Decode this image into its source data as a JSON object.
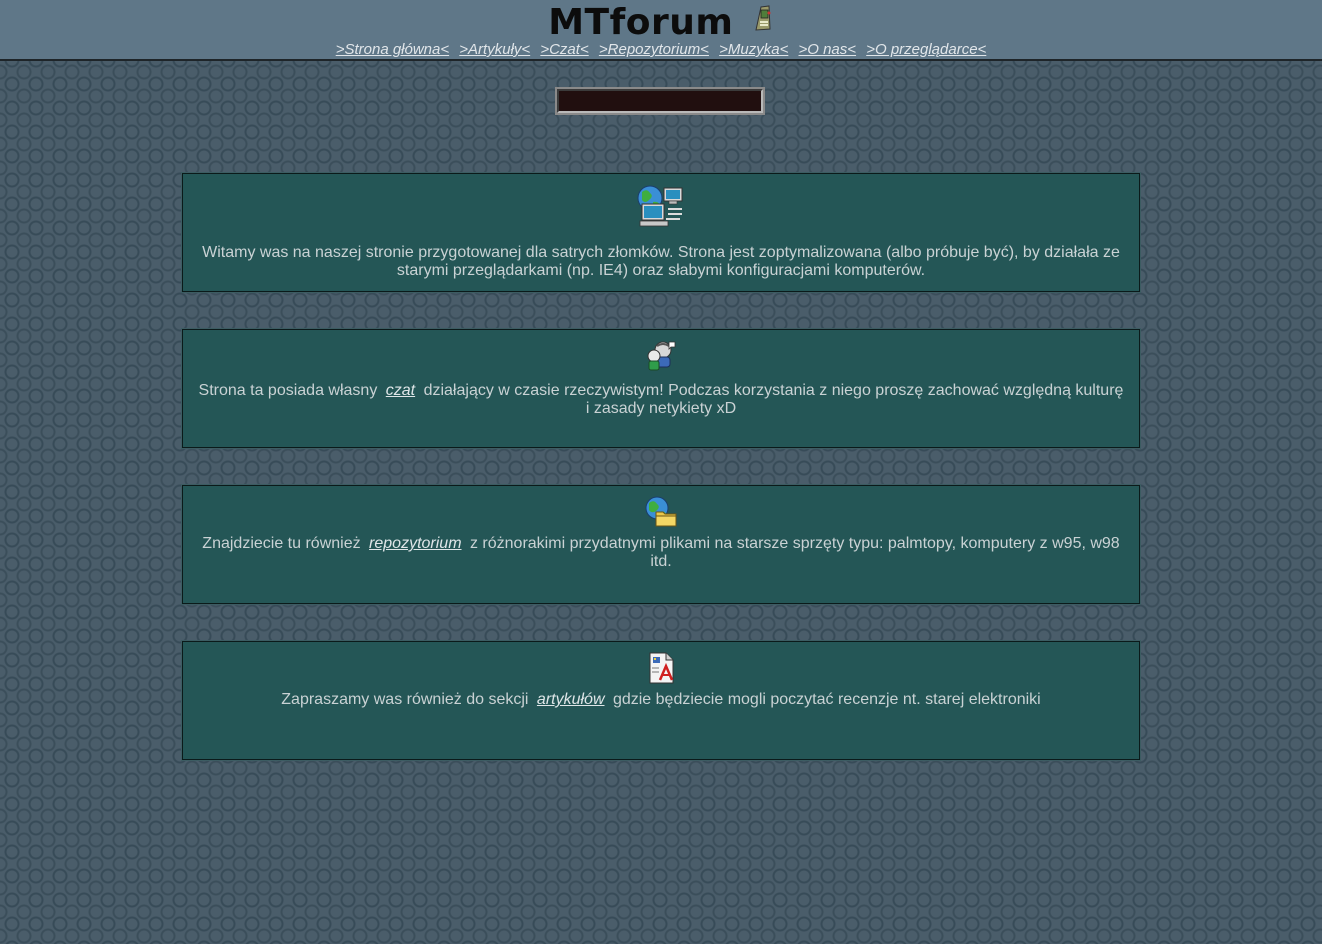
{
  "header": {
    "title": "MTforum",
    "logo_icon": "palmtop-icon",
    "nav": [
      {
        "label": ">Strona główna<"
      },
      {
        "label": ">Artykuły<"
      },
      {
        "label": ">Czat<"
      },
      {
        "label": ">Repozytorium<"
      },
      {
        "label": ">Muzyka<"
      },
      {
        "label": ">O nas<"
      },
      {
        "label": ">O przeglądarce<"
      }
    ]
  },
  "search": {
    "value": ""
  },
  "panels": [
    {
      "icon": "network-computers-icon",
      "before": "Witamy was na naszej stronie przygotowanej dla satrych złomków. Strona jest zoptymalizowana (albo próbuje być), by działała ze starymi przeglądarkami (np. IE4) oraz słabymi konfiguracjami komputerów.",
      "link": "",
      "after": ""
    },
    {
      "icon": "chat-users-icon",
      "before": "Strona ta posiada własny",
      "link": "czat",
      "after": "działający w czasie rzeczywistym! Podczas korzystania z niego proszę zachować względną kulturę i zasady netykiety xD"
    },
    {
      "icon": "globe-folder-icon",
      "before": "Znajdziecie tu również",
      "link": "repozytorium",
      "after": "z różnorakimi przydatnymi plikami na starsze sprzęty typu: palmtopy, komputery z w95, w98 itd."
    },
    {
      "icon": "document-icon",
      "before": "Zapraszamy was również do sekcji",
      "link": "artykułów",
      "after": "gdzie będziecie mogli poczytać recenzje nt. starej elektroniki"
    }
  ],
  "colors": {
    "header_bg": "#5f7788",
    "page_bg": "#4a5d6a",
    "panel_bg": "#245656",
    "panel_text": "#c9d2d4",
    "search_bg": "#210f0f"
  }
}
